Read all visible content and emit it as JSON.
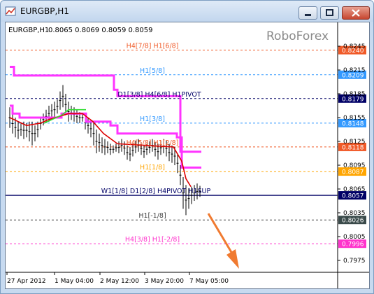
{
  "window": {
    "title": "EURGBP,H1"
  },
  "header": {
    "symbol": "EURGBP,H1",
    "ohlc": "0.8065 0.8069 0.8059 0.8059"
  },
  "watermark": "RoboForex",
  "chart_data": {
    "type": "candlestick",
    "y_ticks": [
      "0.8245",
      "0.8215",
      "0.8185",
      "0.8155",
      "0.8125",
      "0.8095",
      "0.8065",
      "0.8035",
      "0.8005",
      "0.7975"
    ],
    "x_ticks": [
      "27 Apr 2012",
      "1 May 04:00",
      "2 May 12:00",
      "3 May 20:00",
      "7 May 05:00"
    ],
    "levels": [
      {
        "label": "H4[7/8] H1[6/8]",
        "price": "0.8240",
        "color": "#f05a28",
        "price_bg": "#f05a28",
        "style": "dashed"
      },
      {
        "label": "H1[5/8]",
        "price": "0.8209",
        "color": "#3399ff",
        "price_bg": "#3399ff",
        "style": "dashed"
      },
      {
        "label": "D1[3/8] H4[6/8] H1PIVOT",
        "price": "0.8179",
        "color": "#000066",
        "price_bg": "#000066",
        "style": "dashed"
      },
      {
        "label": "H1[3/8]",
        "price": "0.8148",
        "color": "#3399ff",
        "price_bg": "#3399ff",
        "style": "dashed"
      },
      {
        "label": "H4[5/8] H1[2/8]",
        "price": "0.8118",
        "color": "#f05a28",
        "price_bg": "#f05a28",
        "style": "dashed"
      },
      {
        "label": "H1[1/8]",
        "price": "0.8087",
        "color": "#ffa500",
        "price_bg": "#ffa500",
        "style": "dashed"
      },
      {
        "label": "W1[1/8] D1[2/8] H4PIVOT H1SUP",
        "price": "0.8057",
        "color": "#000066",
        "price_bg": "#000066",
        "style": "solid"
      },
      {
        "label": "H1[-1/8]",
        "price": "0.8026",
        "color": "#444444",
        "price_bg": "#3a4a4a",
        "style": "dashed"
      },
      {
        "label": "H4[3/8] H1[-2/8]",
        "price": "0.7996",
        "color": "#ff33cc",
        "price_bg": "#ff33cc",
        "style": "dashed"
      }
    ],
    "colors": {
      "magenta": "#ff33ff",
      "red": "#dd0000",
      "green": "#33dd33",
      "candle": "#000000",
      "arrow": "#f07a30"
    }
  }
}
